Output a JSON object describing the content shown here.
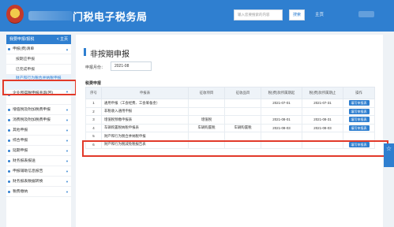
{
  "header": {
    "site_title": "门税电子税务局",
    "search_placeholder": "输入您要搜索的内容",
    "search_button": "搜索",
    "home_link": "主页"
  },
  "sidebar": {
    "head_label": "我要申报/报税",
    "head_link": "< 主页",
    "items": [
      {
        "label": "申报(费)清单",
        "sub": false
      },
      {
        "label": "按期应申报",
        "sub": true
      },
      {
        "label": "已完成申报",
        "sub": true
      },
      {
        "label": "财产和行为税合并纳税申报",
        "sub": true,
        "active": true
      },
      {
        "label": "企业所得税申报查询(回)",
        "sub": false
      },
      {
        "label": "增值税及附加税费申报",
        "sub": false
      },
      {
        "label": "消费税及附加税费申报",
        "sub": false
      },
      {
        "label": "其他申报",
        "sub": false
      },
      {
        "label": "综合申报",
        "sub": false
      },
      {
        "label": "延期申报",
        "sub": false
      },
      {
        "label": "财务报表报送",
        "sub": false
      },
      {
        "label": "申报辅助信息报告",
        "sub": false
      },
      {
        "label": "财务报表数据转换",
        "sub": false
      },
      {
        "label": "税费缴纳",
        "sub": false
      }
    ]
  },
  "main": {
    "page_title": "非按期申报",
    "period_label": "申报月份：",
    "period_value": "2021-08",
    "section_label": "税费申报",
    "columns": [
      "序号",
      "申报表",
      "征收项目",
      "征收品目",
      "税(费)款所属期起",
      "税(费)款所属期止",
      "操作"
    ],
    "rows": [
      {
        "no": "1",
        "form": "通用申报（工会经费、工会筹备金）",
        "item": "",
        "subitem": "",
        "start": "2021-07-01",
        "end": "2021-07-31",
        "op": "填写申报表"
      },
      {
        "no": "2",
        "form": "非税收入通用申报",
        "item": "",
        "subitem": "",
        "start": "",
        "end": "",
        "op": "填写申报表"
      },
      {
        "no": "3",
        "form": "增值税预缴申报表",
        "item": "增值税",
        "subitem": "",
        "start": "2021-08-01",
        "end": "2021-08-31",
        "op": "填写申报表"
      },
      {
        "no": "4",
        "form": "车辆购置税纳税申报表",
        "item": "车辆购置税",
        "subitem": "车辆购置税",
        "start": "2021-08-03",
        "end": "2021-08-03",
        "op": "填写申报表"
      },
      {
        "no": "5",
        "form": "财产和行为税合并纳税申报",
        "item": "",
        "subitem": "",
        "start": "",
        "end": "",
        "op": ""
      },
      {
        "no": "6",
        "form": "财产和行为税减免税报告表",
        "item": "",
        "subitem": "",
        "start": "",
        "end": "",
        "op": "填写申报表"
      }
    ]
  },
  "float_button": "☆"
}
